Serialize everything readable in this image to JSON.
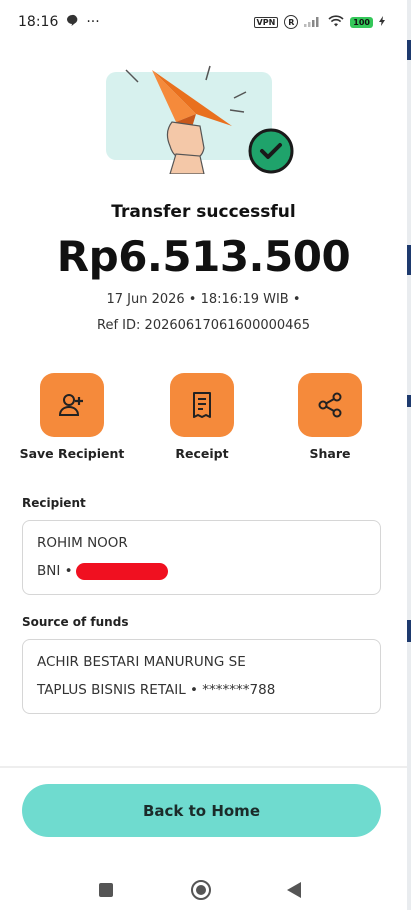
{
  "status_bar": {
    "time": "18:16",
    "dots": "···",
    "vpn": "VPN",
    "r": "R",
    "battery": "100"
  },
  "result": {
    "title": "Transfer successful",
    "amount": "Rp6.513.500",
    "datetime": "17 Jun 2026 • 18:16:19 WIB •",
    "ref_id": "Ref ID: 20260617061600000465"
  },
  "actions": [
    {
      "label": "Save Recipient",
      "icon": "add-person-icon"
    },
    {
      "label": "Receipt",
      "icon": "receipt-icon"
    },
    {
      "label": "Share",
      "icon": "share-icon"
    }
  ],
  "recipient": {
    "section_label": "Recipient",
    "name": "ROHIM NOOR",
    "bank_prefix": "BNI •"
  },
  "source": {
    "section_label": "Source of funds",
    "name": "ACHIR BESTARI MANURUNG SE",
    "account": "TAPLUS BISNIS RETAIL • *******788"
  },
  "footer": {
    "home_label": "Back to Home"
  },
  "colors": {
    "accent_orange": "#f58a3b",
    "accent_teal": "#6fdbcf",
    "success_green": "#1fa36b"
  }
}
